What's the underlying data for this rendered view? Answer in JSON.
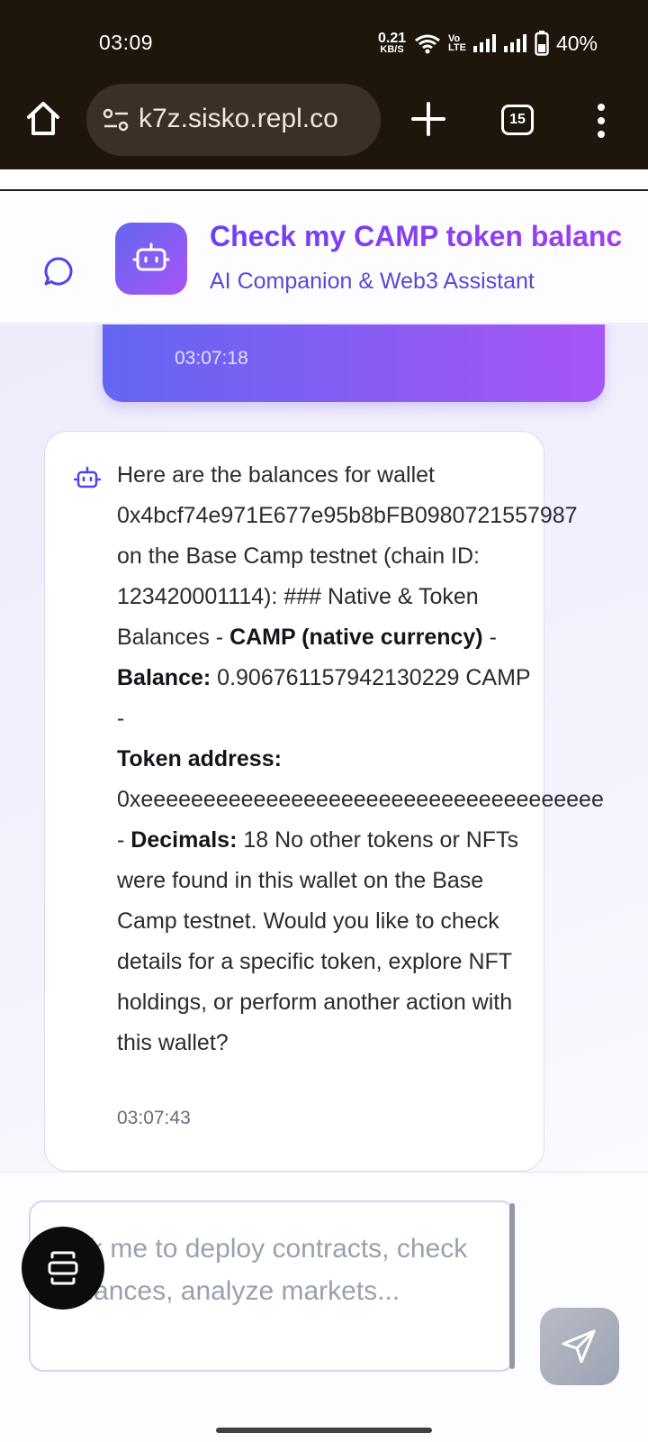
{
  "status_bar": {
    "time": "03:09",
    "net_speed_value": "0.21",
    "net_speed_unit": "KB/S",
    "volte_top": "Vo",
    "volte_bottom": "LTE",
    "battery": "40%"
  },
  "browser": {
    "url": "k7z.sisko.repl.co",
    "tab_count": "15"
  },
  "header": {
    "title": "Check my CAMP token balanc",
    "subtitle": "AI Companion & Web3 Assistant"
  },
  "messages": {
    "user_time": "03:07:18",
    "bot": {
      "intro": "Here are the balances for wallet",
      "wallet": "0x4bcf74e971E677e95b8bFB0980721557987",
      "context": "on the Base Camp testnet (chain ID: 123420001114): ### Native & Token Balances - ",
      "camp_label": "CAMP (native currency)",
      "dash1": " - ",
      "balance_label": "Balance:",
      "balance_value": " 0.906761157942130229 CAMP - ",
      "token_address_label": "Token address:",
      "token_address_value": "0xeeeeeeeeeeeeeeeeeeeeeeeeeeeeeeeeeeeee",
      "dash2": "- ",
      "decimals_label": "Decimals:",
      "decimals_value": " 18 No other tokens or NFTs were found in this wallet on the Base Camp testnet. Would you like to check details for a specific token, explore NFT holdings, or perform another action with this wallet?",
      "time": "03:07:43"
    }
  },
  "composer": {
    "placeholder": "Ask me to deploy contracts, check balances, analyze markets..."
  }
}
